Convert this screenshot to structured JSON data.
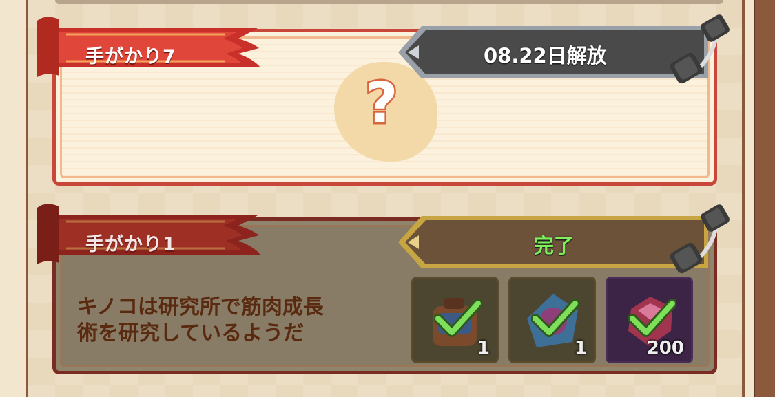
{
  "clue_locked": {
    "title": "手がかり7",
    "status": "08.22日解放",
    "placeholder_symbol": "?"
  },
  "clue_done": {
    "title": "手がかり1",
    "status": "完了",
    "description_line1": "キノコは研究所で筋肉成長",
    "description_line2": "術を研究しているようだ",
    "rewards": [
      {
        "icon": "backpack-icon",
        "count": "1",
        "claimed": true
      },
      {
        "icon": "crystal-orb-icon",
        "count": "1",
        "claimed": true
      },
      {
        "icon": "ruby-gem-icon",
        "count": "200",
        "claimed": true
      }
    ]
  },
  "colors": {
    "ribbon_red": "#c9473a",
    "locked_bar": "#4a4a4a",
    "done_bar": "#6b5238",
    "done_text": "#7ef05a",
    "reward_purple": "#3c2447"
  }
}
